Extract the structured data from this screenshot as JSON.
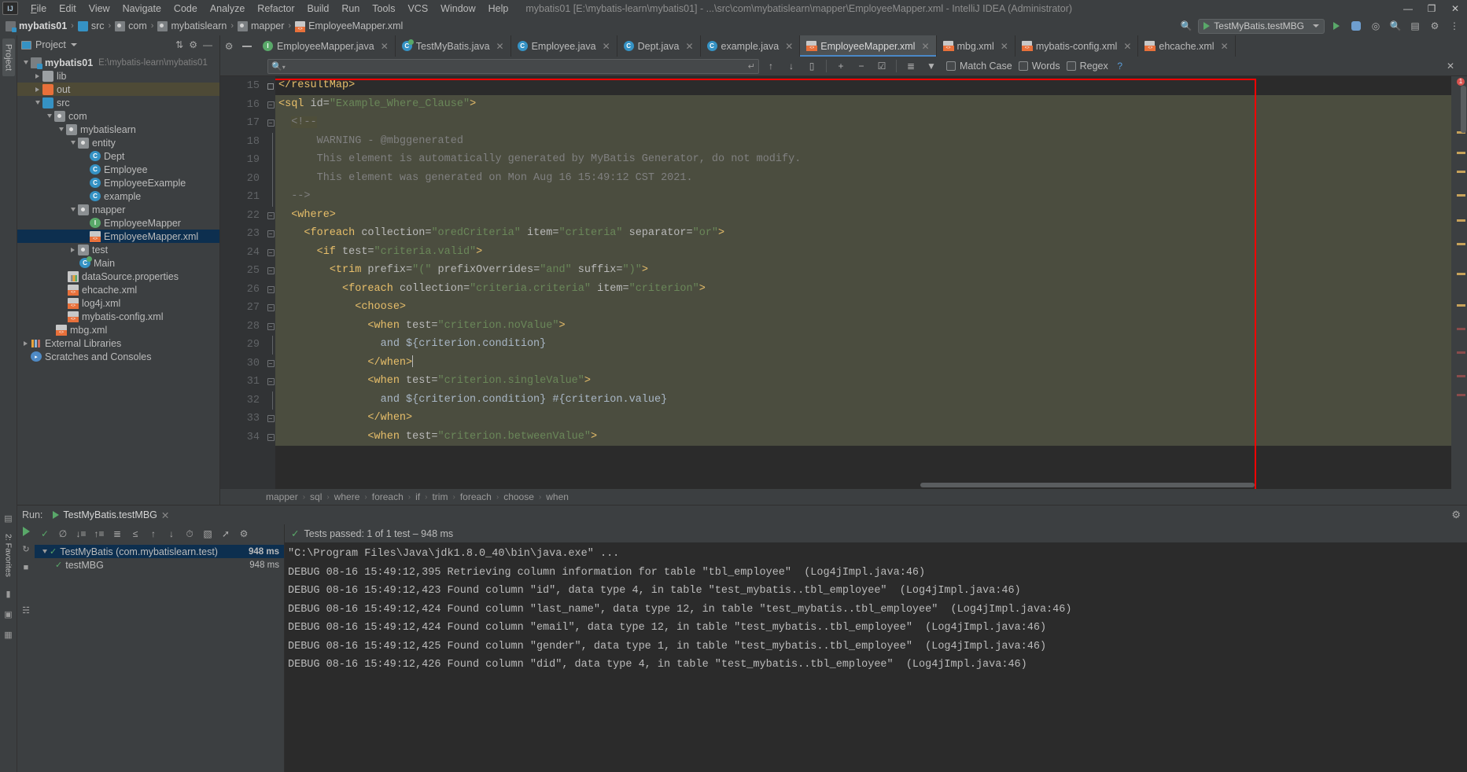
{
  "window": {
    "title": "mybatis01 [E:\\mybatis-learn\\mybatis01] - ...\\src\\com\\mybatislearn\\mapper\\EmployeeMapper.xml - IntelliJ IDEA (Administrator)",
    "minimize": "—",
    "maximize": "❐",
    "close": "✕",
    "logo": "IJ"
  },
  "menubar": [
    {
      "label": "File"
    },
    {
      "label": "Edit"
    },
    {
      "label": "View"
    },
    {
      "label": "Navigate"
    },
    {
      "label": "Code"
    },
    {
      "label": "Analyze"
    },
    {
      "label": "Refactor"
    },
    {
      "label": "Build"
    },
    {
      "label": "Run"
    },
    {
      "label": "Tools"
    },
    {
      "label": "VCS"
    },
    {
      "label": "Window"
    },
    {
      "label": "Help"
    }
  ],
  "breadcrumb": {
    "items": [
      {
        "label": "mybatis01",
        "icon": "module-icon",
        "bold": true
      },
      {
        "label": "src",
        "icon": "source-folder-icon",
        "bold": false
      },
      {
        "label": "com",
        "icon": "package-icon",
        "bold": false
      },
      {
        "label": "mybatislearn",
        "icon": "package-icon",
        "bold": false
      },
      {
        "label": "mapper",
        "icon": "package-icon",
        "bold": false
      },
      {
        "label": "EmployeeMapper.xml",
        "icon": "xml-file-icon",
        "bold": false
      }
    ],
    "separator": "›"
  },
  "toolbar_right": {
    "run_config": "TestMyBatis.testMBG",
    "search_icon": "🔍",
    "run_icon": "run-icon",
    "debug_icon": "debug-icon",
    "coverage_icon": "coverage-icon",
    "inspect_icon": "inspect-icon",
    "layout_icon": "layout-icon",
    "settings_icon": "settings-icon"
  },
  "project_panel": {
    "title": "Project",
    "collapse_icon": "collapse-all-icon",
    "settings_icon": "gear-icon",
    "hide_icon": "hide-icon",
    "tree": [
      {
        "label": "mybatis01",
        "path": "E:\\mybatis-learn\\mybatis01",
        "indent": 0,
        "arrow": "down",
        "icon": "module-icon",
        "bold": true,
        "state": "normal"
      },
      {
        "label": "lib",
        "indent": 1,
        "arrow": "right",
        "icon": "folder-icon",
        "state": "normal"
      },
      {
        "label": "out",
        "indent": 1,
        "arrow": "right",
        "icon": "folder-orange-icon",
        "state": "highlight"
      },
      {
        "label": "src",
        "indent": 1,
        "arrow": "down",
        "icon": "folder-blue-icon",
        "state": "normal"
      },
      {
        "label": "com",
        "indent": 2,
        "arrow": "down",
        "icon": "package-icon",
        "state": "normal"
      },
      {
        "label": "mybatislearn",
        "indent": 3,
        "arrow": "down",
        "icon": "package-icon",
        "state": "normal"
      },
      {
        "label": "entity",
        "indent": 4,
        "arrow": "down",
        "icon": "package-icon",
        "state": "normal"
      },
      {
        "label": "Dept",
        "indent": 5,
        "arrow": "none",
        "icon": "class-icon",
        "state": "normal"
      },
      {
        "label": "Employee",
        "indent": 5,
        "arrow": "none",
        "icon": "class-icon",
        "state": "normal"
      },
      {
        "label": "EmployeeExample",
        "indent": 5,
        "arrow": "none",
        "icon": "class-icon",
        "state": "normal"
      },
      {
        "label": "example",
        "indent": 5,
        "arrow": "none",
        "icon": "class-icon",
        "state": "normal"
      },
      {
        "label": "mapper",
        "indent": 4,
        "arrow": "down",
        "icon": "package-icon",
        "state": "normal"
      },
      {
        "label": "EmployeeMapper",
        "indent": 5,
        "arrow": "none",
        "icon": "interface-icon",
        "state": "normal"
      },
      {
        "label": "EmployeeMapper.xml",
        "indent": 5,
        "arrow": "none",
        "icon": "xml-file-icon",
        "state": "selected"
      },
      {
        "label": "test",
        "indent": 4,
        "arrow": "right",
        "icon": "package-icon",
        "state": "normal"
      },
      {
        "label": "Main",
        "indent": 4,
        "arrow": "none",
        "icon": "runnable-class-icon",
        "state": "normal"
      },
      {
        "label": "dataSource.properties",
        "indent": 3,
        "arrow": "none",
        "icon": "properties-icon",
        "state": "normal"
      },
      {
        "label": "ehcache.xml",
        "indent": 3,
        "arrow": "none",
        "icon": "xml-file-icon",
        "state": "normal"
      },
      {
        "label": "log4j.xml",
        "indent": 3,
        "arrow": "none",
        "icon": "xml-file-icon",
        "state": "normal"
      },
      {
        "label": "mybatis-config.xml",
        "indent": 3,
        "arrow": "none",
        "icon": "xml-file-icon",
        "state": "normal"
      },
      {
        "label": "mbg.xml",
        "indent": 2,
        "arrow": "none",
        "icon": "xml-file-icon",
        "state": "normal"
      },
      {
        "label": "External Libraries",
        "indent": 0,
        "arrow": "right",
        "icon": "libraries-icon",
        "state": "normal"
      },
      {
        "label": "Scratches and Consoles",
        "indent": 0,
        "arrow": "none",
        "icon": "scratches-icon",
        "state": "normal"
      }
    ]
  },
  "editor_tabs": [
    {
      "label": "EmployeeMapper.java",
      "icon": "interface-icon",
      "active": false
    },
    {
      "label": "TestMyBatis.java",
      "icon": "runnable-class-icon",
      "active": false
    },
    {
      "label": "Employee.java",
      "icon": "class-icon",
      "active": false
    },
    {
      "label": "Dept.java",
      "icon": "class-icon",
      "active": false
    },
    {
      "label": "example.java",
      "icon": "class-icon",
      "active": false
    },
    {
      "label": "EmployeeMapper.xml",
      "icon": "xml-file-icon",
      "active": true
    },
    {
      "label": "mbg.xml",
      "icon": "xml-file-icon",
      "active": false
    },
    {
      "label": "mybatis-config.xml",
      "icon": "xml-file-icon",
      "active": false
    },
    {
      "label": "ehcache.xml",
      "icon": "xml-file-icon",
      "active": false
    }
  ],
  "find_bar": {
    "query_value": "",
    "query_placeholder": "",
    "search_icon": "🔍",
    "history_icon": "↵",
    "prev_icon": "↑",
    "next_icon": "↓",
    "select_all_icon": "select-all-occurrences-icon",
    "add_icon": "+",
    "remove_icon": "−",
    "select_occurrence_icon": "☑",
    "filter_icon": "filter-icon",
    "funnel_icon": "funnel-icon",
    "options": [
      {
        "label": "Match Case",
        "checked": false
      },
      {
        "label": "Words",
        "checked": false
      },
      {
        "label": "Regex",
        "checked": false
      }
    ],
    "help_label": "?",
    "close_icon": "✕"
  },
  "editor": {
    "first_line": 15,
    "lines": [
      {
        "num": 15,
        "tokens": [
          {
            "t": "</resultMap>",
            "c": "t-tag"
          }
        ],
        "indent": 0,
        "highlight": false
      },
      {
        "num": 16,
        "tokens": [
          {
            "t": "<sql ",
            "c": "t-tag"
          },
          {
            "t": "id=",
            "c": "t-attr"
          },
          {
            "t": "\"Example_Where_Clause\"",
            "c": "t-val"
          },
          {
            "t": ">",
            "c": "t-tag"
          }
        ],
        "indent": 1,
        "highlight": true
      },
      {
        "num": 17,
        "tokens": [
          {
            "t": "<!--",
            "c": "t-cmt"
          }
        ],
        "indent": 2,
        "highlight": true
      },
      {
        "num": 18,
        "tokens": [
          {
            "t": "  WARNING - @mbggenerated",
            "c": "t-cmt"
          }
        ],
        "indent": 3,
        "highlight": true
      },
      {
        "num": 19,
        "tokens": [
          {
            "t": "  This element is automatically generated by MyBatis Generator, do not modify.",
            "c": "t-cmt"
          }
        ],
        "indent": 3,
        "highlight": true
      },
      {
        "num": 20,
        "tokens": [
          {
            "t": "  This element was generated on Mon Aug 16 15:49:12 CST 2021.",
            "c": "t-cmt"
          }
        ],
        "indent": 3,
        "highlight": true
      },
      {
        "num": 21,
        "tokens": [
          {
            "t": "-->",
            "c": "t-cmt"
          }
        ],
        "indent": 2,
        "highlight": true
      },
      {
        "num": 22,
        "tokens": [
          {
            "t": "<where>",
            "c": "t-tag"
          }
        ],
        "indent": 2,
        "highlight": true
      },
      {
        "num": 23,
        "tokens": [
          {
            "t": "<foreach ",
            "c": "t-tag"
          },
          {
            "t": "collection=",
            "c": "t-attr"
          },
          {
            "t": "\"oredCriteria\"",
            "c": "t-val"
          },
          {
            "t": " item=",
            "c": "t-attr"
          },
          {
            "t": "\"criteria\"",
            "c": "t-val"
          },
          {
            "t": " separator=",
            "c": "t-attr"
          },
          {
            "t": "\"or\"",
            "c": "t-val"
          },
          {
            "t": ">",
            "c": "t-tag"
          }
        ],
        "indent": 3,
        "highlight": true
      },
      {
        "num": 24,
        "tokens": [
          {
            "t": "<if ",
            "c": "t-tag"
          },
          {
            "t": "test=",
            "c": "t-attr"
          },
          {
            "t": "\"criteria.valid\"",
            "c": "t-val"
          },
          {
            "t": ">",
            "c": "t-tag"
          }
        ],
        "indent": 4,
        "highlight": true
      },
      {
        "num": 25,
        "tokens": [
          {
            "t": "<trim ",
            "c": "t-tag"
          },
          {
            "t": "prefix=",
            "c": "t-attr"
          },
          {
            "t": "\"(\"",
            "c": "t-val"
          },
          {
            "t": " prefixOverrides=",
            "c": "t-attr"
          },
          {
            "t": "\"and\"",
            "c": "t-val"
          },
          {
            "t": " suffix=",
            "c": "t-attr"
          },
          {
            "t": "\")\"",
            "c": "t-val"
          },
          {
            "t": ">",
            "c": "t-tag"
          }
        ],
        "indent": 5,
        "highlight": true
      },
      {
        "num": 26,
        "tokens": [
          {
            "t": "<foreach ",
            "c": "t-tag"
          },
          {
            "t": "collection=",
            "c": "t-attr"
          },
          {
            "t": "\"criteria.criteria\"",
            "c": "t-val"
          },
          {
            "t": " item=",
            "c": "t-attr"
          },
          {
            "t": "\"criterion\"",
            "c": "t-val"
          },
          {
            "t": ">",
            "c": "t-tag"
          }
        ],
        "indent": 6,
        "highlight": true
      },
      {
        "num": 27,
        "tokens": [
          {
            "t": "<choose>",
            "c": "t-tag"
          }
        ],
        "indent": 7,
        "highlight": true
      },
      {
        "num": 28,
        "tokens": [
          {
            "t": "<when ",
            "c": "t-tag"
          },
          {
            "t": "test=",
            "c": "t-attr"
          },
          {
            "t": "\"criterion.noValue\"",
            "c": "t-val"
          },
          {
            "t": ">",
            "c": "t-tag"
          }
        ],
        "indent": 8,
        "highlight": true
      },
      {
        "num": 29,
        "tokens": [
          {
            "t": "and ${criterion.condition}",
            "c": "t-txt"
          }
        ],
        "indent": 9,
        "highlight": true
      },
      {
        "num": 30,
        "tokens": [
          {
            "t": "</when>",
            "c": "t-tag"
          }
        ],
        "indent": 8,
        "highlight": true,
        "caret": true
      },
      {
        "num": 31,
        "tokens": [
          {
            "t": "<when ",
            "c": "t-tag"
          },
          {
            "t": "test=",
            "c": "t-attr"
          },
          {
            "t": "\"criterion.singleValue\"",
            "c": "t-val"
          },
          {
            "t": ">",
            "c": "t-tag"
          }
        ],
        "indent": 8,
        "highlight": true
      },
      {
        "num": 32,
        "tokens": [
          {
            "t": "and ${criterion.condition} #{criterion.value}",
            "c": "t-txt"
          }
        ],
        "indent": 9,
        "highlight": true
      },
      {
        "num": 33,
        "tokens": [
          {
            "t": "</when>",
            "c": "t-tag"
          }
        ],
        "indent": 8,
        "highlight": true
      },
      {
        "num": 34,
        "tokens": [
          {
            "t": "<when ",
            "c": "t-tag"
          },
          {
            "t": "test=",
            "c": "t-attr"
          },
          {
            "t": "\"criterion.betweenValue\"",
            "c": "t-val"
          },
          {
            "t": ">",
            "c": "t-tag"
          }
        ],
        "indent": 8,
        "highlight": true
      }
    ],
    "error_count": "1",
    "crumbs": [
      "mapper",
      "sql",
      "where",
      "foreach",
      "if",
      "trim",
      "foreach",
      "choose",
      "when"
    ],
    "crumb_separator": "›"
  },
  "run_panel": {
    "label": "Run:",
    "tab_name": "TestMyBatis.testMBG",
    "tab_close": "✕",
    "settings_icon": "gear-icon",
    "status": "Tests passed: 1 of 1 test – 948 ms",
    "status_icon": "✓",
    "toolbar_icons": [
      "rerun-icon",
      "rerun-failed-icon",
      "stop-icon",
      "trace-icon"
    ],
    "left_tools": [
      "expand-all-icon",
      "collapse-all-icon",
      "sort-alphabetically-icon",
      "sort-by-duration-icon",
      "show-passed-icon",
      "prev-icon",
      "next-icon",
      "history-icon",
      "statistics-icon",
      "export-icon",
      "settings-icon"
    ],
    "tests": [
      {
        "label": "TestMyBatis (com.mybatislearn.test)",
        "time": "948 ms",
        "indent": 0,
        "arrow": "down",
        "selected": true,
        "bold_time": true
      },
      {
        "label": "testMBG",
        "time": "948 ms",
        "indent": 1,
        "arrow": "none",
        "selected": false,
        "bold_time": false
      }
    ],
    "console": [
      {
        "text": "\"C:\\Program Files\\Java\\jdk1.8.0_40\\bin\\java.exe\" ...",
        "kind": "cmd"
      },
      {
        "text": "DEBUG 08-16 15:49:12,395 Retrieving column information for table \"tbl_employee\"  (Log4jImpl.java:46)",
        "kind": "dbg"
      },
      {
        "text": "DEBUG 08-16 15:49:12,423 Found column \"id\", data type 4, in table \"test_mybatis..tbl_employee\"  (Log4jImpl.java:46)",
        "kind": "dbg"
      },
      {
        "text": "DEBUG 08-16 15:49:12,424 Found column \"last_name\", data type 12, in table \"test_mybatis..tbl_employee\"  (Log4jImpl.java:46)",
        "kind": "dbg"
      },
      {
        "text": "DEBUG 08-16 15:49:12,424 Found column \"email\", data type 12, in table \"test_mybatis..tbl_employee\"  (Log4jImpl.java:46)",
        "kind": "dbg"
      },
      {
        "text": "DEBUG 08-16 15:49:12,425 Found column \"gender\", data type 1, in table \"test_mybatis..tbl_employee\"  (Log4jImpl.java:46)",
        "kind": "dbg"
      },
      {
        "text": "DEBUG 08-16 15:49:12,426 Found column \"did\", data type 4, in table \"test_mybatis..tbl_employee\"  (Log4jImpl.java:46)",
        "kind": "dbg"
      }
    ]
  },
  "side_strips": {
    "left_top": "Project",
    "left_bottom_items": [
      "structure-icon",
      "favorites-icon",
      "terminal-icon",
      "todo-icon",
      "grid-icon"
    ]
  },
  "colors": {
    "accent": "#4a88c7",
    "highlight_bg": "#4b4d3f",
    "selection_bg": "#0d2f4f",
    "annotation_box": "#ff0000",
    "success": "#59a869",
    "panel_bg": "#3c3f41",
    "editor_bg": "#2b2b2b"
  }
}
